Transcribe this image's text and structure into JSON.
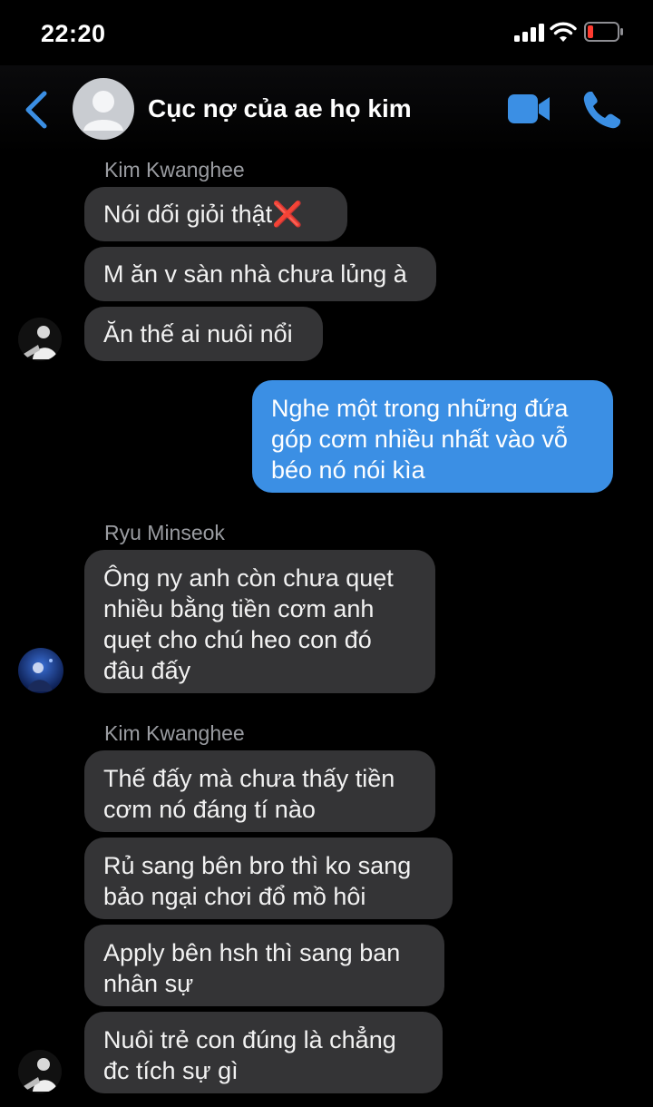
{
  "status_bar": {
    "time": "22:20"
  },
  "header": {
    "title": "Cục nợ của ae họ kim"
  },
  "messages": {
    "g1_sender": "Kim Kwanghee",
    "m1": "Nói dối giỏi thật",
    "m1_emoji": "❌",
    "m2": "M ăn v sàn nhà chưa lủng à",
    "m3": "Ăn thế ai nuôi nổi",
    "m4_l1": "Nghe một trong những đứa",
    "m4_l2": "góp cơm nhiều nhất vào vỗ",
    "m4_l3": "béo nó nói kìa",
    "g2_sender": "Ryu Minseok",
    "m5_l1": "Ông ny anh còn chưa quẹt",
    "m5_l2": "nhiều bằng tiền cơm anh",
    "m5_l3": "quẹt cho chú heo con đó",
    "m5_l4": "đâu đấy",
    "g3_sender": "Kim Kwanghee",
    "m6_l1": "Thế đấy mà chưa thấy tiền",
    "m6_l2": "cơm nó đáng tí nào",
    "m7_l1": "Rủ sang bên bro thì ko sang",
    "m7_l2": "bảo ngại chơi đổ mồ hôi",
    "m8_l1": "Apply bên hsh thì sang ban",
    "m8_l2": "nhân sự",
    "m9_l1": "Nuôi trẻ con đúng là chẳng",
    "m9_l2": "đc tích sự gì"
  },
  "colors": {
    "incoming": "#343436",
    "outgoing": "#3b8fe4",
    "accent": "#3b8fe4",
    "battery_low": "#ff3b30"
  }
}
